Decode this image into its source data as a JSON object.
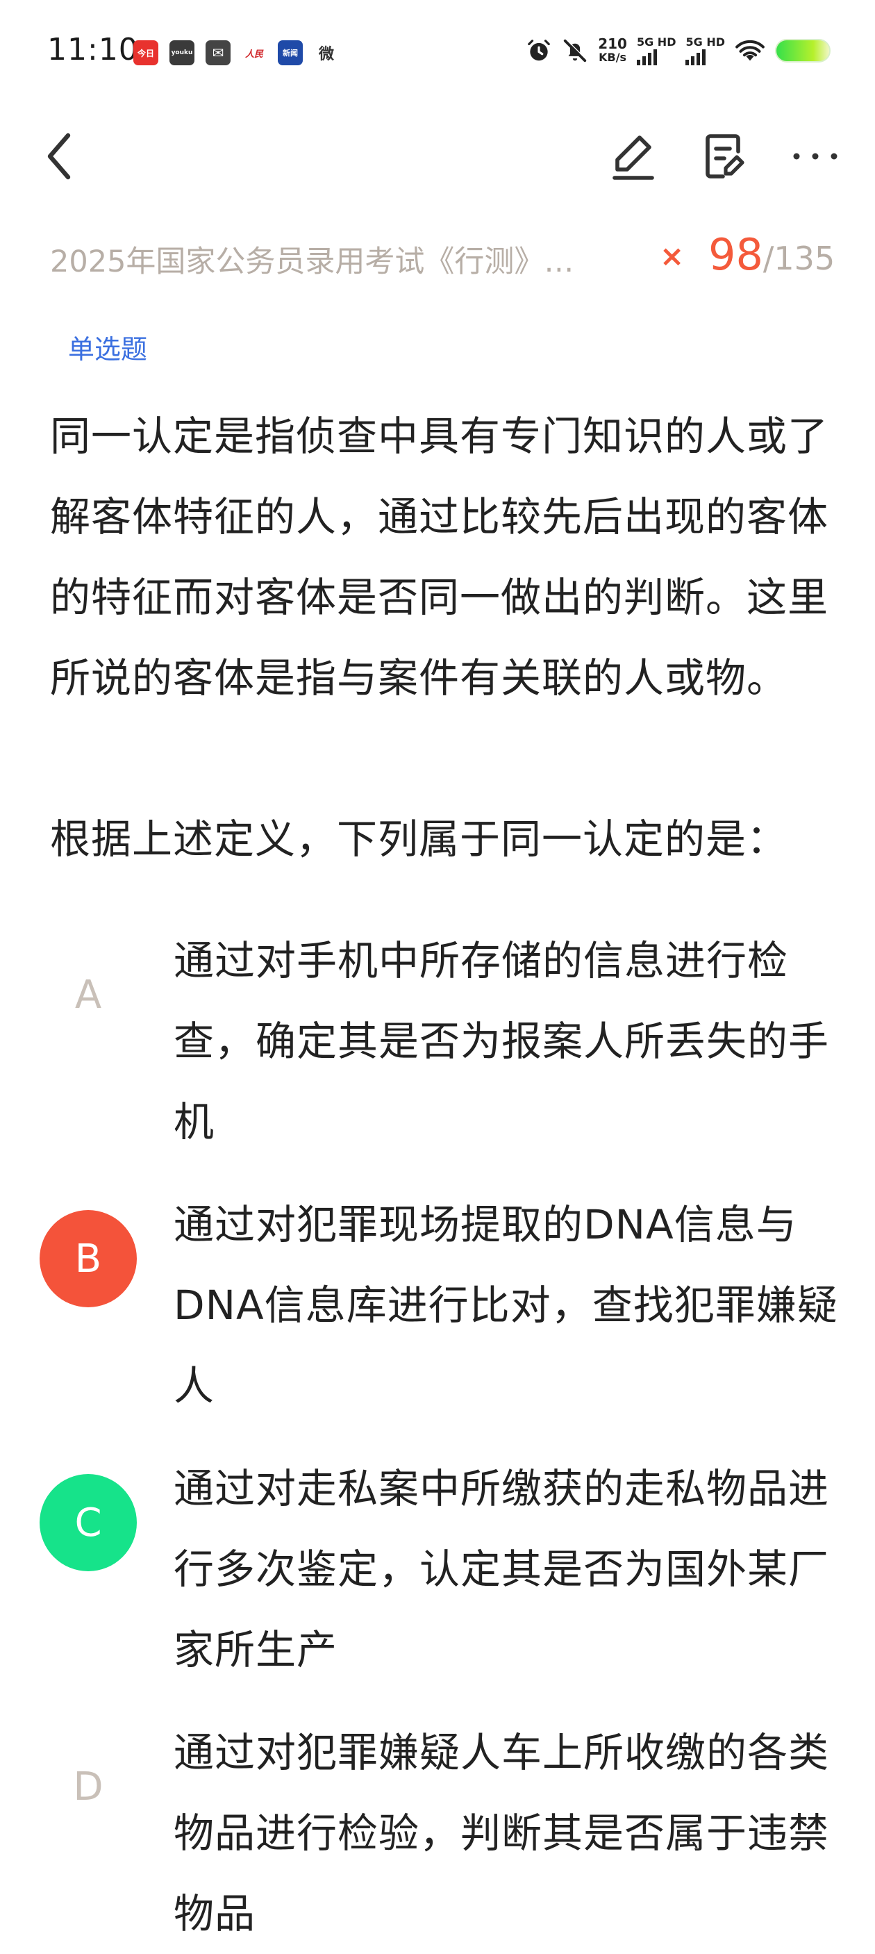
{
  "status_bar": {
    "time": "11:10",
    "notification_icons": [
      {
        "name": "app-icon-1",
        "glyph": "今日"
      },
      {
        "name": "youku-icon",
        "glyph": "youku"
      },
      {
        "name": "mail-icon",
        "glyph": "✉"
      },
      {
        "name": "peoples-daily-icon",
        "glyph": "人民"
      },
      {
        "name": "news-app-icon",
        "glyph": "新闻"
      },
      {
        "name": "weibo-icon",
        "glyph": "微"
      }
    ],
    "net_speed_value": "210",
    "net_speed_unit": "KB/s",
    "sim1_label": "5G HD",
    "sim2_label": "5G HD",
    "colors": {
      "battery": "#35e04a"
    }
  },
  "toolbar": {
    "back_icon": "chevron-left-icon",
    "edit_icon": "pencil-icon",
    "note_icon": "note-edit-icon",
    "more_icon": "more-horizontal-icon"
  },
  "question": {
    "title": "2025年国家公务员录用考试《行测》…",
    "status_mark": "×",
    "current_index": "98",
    "separator": "/",
    "total": "135",
    "type_label": "单选题",
    "stem": "同一认定是指侦查中具有专门知识的人或了解客体特征的人，通过比较先后出现的客体的特征而对客体是否同一做出的判断。这里所说的客体是指与案件有关联的人或物。",
    "prompt": "根据上述定义，下列属于同一认定的是：",
    "options": [
      {
        "letter": "A",
        "text": "通过对手机中所存储的信息进行检查，确定其是否为报案人所丢失的手机",
        "state": "normal"
      },
      {
        "letter": "B",
        "text": "通过对犯罪现场提取的DNA信息与DNA信息库进行比对，查找犯罪嫌疑人",
        "state": "wrong"
      },
      {
        "letter": "C",
        "text": "通过对走私案中所缴获的走私物品进行多次鉴定，认定其是否为国外某厂家所生产",
        "state": "correct"
      },
      {
        "letter": "D",
        "text": "通过对犯罪嫌疑人车上所收缴的各类物品进行检验，判断其是否属于违禁物品",
        "state": "normal"
      }
    ],
    "colors": {
      "accent": "#f45a3b",
      "wrong": "#f4533a",
      "correct": "#16e38a",
      "type_label": "#3a6fe0"
    }
  }
}
